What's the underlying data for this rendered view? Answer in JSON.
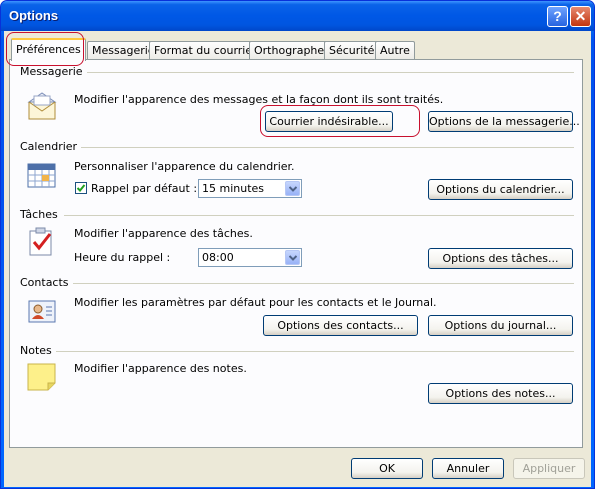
{
  "window": {
    "title": "Options",
    "help_glyph": "?",
    "close_glyph": "✕"
  },
  "tabs": [
    {
      "label": "Préférences"
    },
    {
      "label": "Messagerie"
    },
    {
      "label": "Format du courrier"
    },
    {
      "label": "Orthographe"
    },
    {
      "label": "Sécurité"
    },
    {
      "label": "Autre"
    }
  ],
  "sections": {
    "mail": {
      "heading": "Messagerie",
      "description": "Modifier l'apparence des messages et la façon dont ils sont traités.",
      "junk_button": "Courrier indésirable...",
      "options_button": "Options de la messagerie...",
      "icon": "mail-envelope-icon"
    },
    "calendar": {
      "heading": "Calendrier",
      "description": "Personnaliser l'apparence du calendrier.",
      "reminder_label": "Rappel par défaut :",
      "reminder_checked": true,
      "reminder_value": "15 minutes",
      "options_button": "Options du calendrier...",
      "icon": "calendar-icon"
    },
    "tasks": {
      "heading": "Tâches",
      "description": "Modifier l'apparence des tâches.",
      "reminder_time_label": "Heure du rappel :",
      "reminder_time_value": "08:00",
      "options_button": "Options des tâches...",
      "icon": "task-checklist-icon"
    },
    "contacts": {
      "heading": "Contacts",
      "description": "Modifier les paramètres par défaut pour les contacts et le Journal.",
      "contacts_button": "Options des contacts...",
      "journal_button": "Options du journal...",
      "icon": "contact-card-icon"
    },
    "notes": {
      "heading": "Notes",
      "description": "Modifier l'apparence des notes.",
      "options_button": "Options des notes...",
      "icon": "sticky-note-icon"
    }
  },
  "footer": {
    "ok": "OK",
    "cancel": "Annuler",
    "apply": "Appliquer"
  },
  "colors": {
    "highlight_ring": "#c8102e",
    "titlebar": "#0058e6"
  }
}
